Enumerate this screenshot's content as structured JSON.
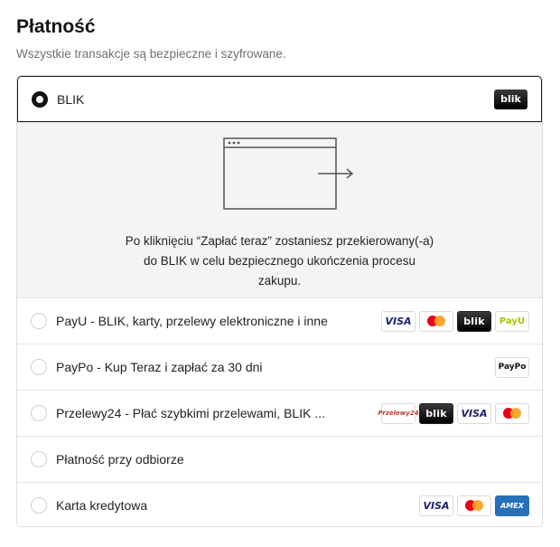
{
  "header": {
    "title": "Płatność",
    "subtitle": "Wszystkie transakcje są bezpieczne i szyfrowane."
  },
  "payment_options": [
    {
      "label": "BLIK",
      "selected": true,
      "logos": [
        "blik"
      ]
    },
    {
      "label": "PayU - BLIK, karty, przelewy elektroniczne i inne",
      "selected": false,
      "logos": [
        "visa",
        "mastercard",
        "blik",
        "payu"
      ]
    },
    {
      "label": "PayPo - Kup Teraz i zapłać za 30 dni",
      "selected": false,
      "logos": [
        "paypo"
      ]
    },
    {
      "label": "Przelewy24 - Płać szybkimi przelewami, BLIK ...",
      "selected": false,
      "logos": [
        "przelewy24",
        "blik",
        "visa",
        "mastercard"
      ]
    },
    {
      "label": "Płatność przy odbiorze",
      "selected": false,
      "logos": []
    },
    {
      "label": "Karta kredytowa",
      "selected": false,
      "logos": [
        "visa",
        "mastercard",
        "amex"
      ]
    }
  ],
  "blik_detail": {
    "line1": "Po kliknięciu “Zapłać teraz” zostaniesz przekierowany(-a)",
    "line2": "do BLIK w celu bezpiecznego ukończenia procesu",
    "line3": "zakupu."
  },
  "logo_text": {
    "visa": "VISA",
    "blik": "blik",
    "payu": "PayU",
    "paypo": "PayPo",
    "przelewy24": "Przelewy24",
    "amex": "AMEX"
  },
  "colors": {
    "selected_border": "#1a1a1a",
    "detail_background": "#f4f4f4",
    "visa": "#1a1f71",
    "mastercard_red": "#eb001b",
    "mastercard_orange": "#f79e1b",
    "amex": "#2671b9",
    "payu": "#a5c400"
  }
}
